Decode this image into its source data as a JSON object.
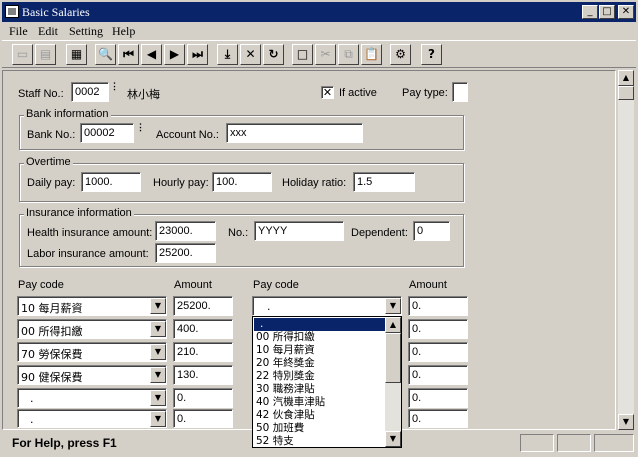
{
  "window": {
    "title": "Basic Salaries",
    "min_label": "_",
    "max_label": "□",
    "close_label": "✕"
  },
  "menu": [
    "File",
    "Edit",
    "Setting",
    "Help"
  ],
  "toolbar": {
    "icons": [
      "print-preview-icon",
      "print-icon",
      "list-view-icon",
      "search-icon",
      "first-record-icon",
      "previous-record-icon",
      "next-record-icon",
      "last-record-icon",
      "save-icon",
      "cancel-icon",
      "refresh-icon",
      "new-record-icon",
      "cut-icon",
      "copy-icon",
      "paste-icon",
      "settings-icon",
      "help-icon"
    ],
    "glyphs": [
      "▭",
      "▤",
      "▦",
      "🔍",
      "⏮",
      "◀",
      "▶",
      "⏭",
      "⤓",
      "✕",
      "↻",
      "□",
      "✂",
      "⧉",
      "📋",
      "⚙",
      "?"
    ]
  },
  "staff": {
    "label": "Staff No.:",
    "value": "0002",
    "name": "林小梅",
    "if_active_label": "If active",
    "if_active_checked": true,
    "pay_type_label": "Pay type:",
    "pay_type_value": ""
  },
  "bank": {
    "title": "Bank information",
    "bank_no_label": "Bank No.:",
    "bank_no_value": "00002",
    "account_label": "Account No.:",
    "account_value": "xxx"
  },
  "overtime": {
    "title": "Overtime",
    "daily_label": "Daily pay:",
    "daily_value": "1000.",
    "hourly_label": "Hourly pay:",
    "hourly_value": "100.",
    "holiday_label": "Holiday ratio:",
    "holiday_value": "1.5"
  },
  "insurance": {
    "title": "Insurance information",
    "health_label": "Health insurance amount:",
    "health_value": "23000.",
    "no_label": "No.:",
    "no_value": "YYYY",
    "dependent_label": "Dependent:",
    "dependent_value": "0",
    "labor_label": "Labor insurance amount:",
    "labor_value": "25200."
  },
  "paygrid": {
    "pay_code_header": "Pay code",
    "amount_header": "Amount",
    "left_rows": [
      {
        "code": "10 每月薪資",
        "amount": "25200."
      },
      {
        "code": "00 所得扣繳",
        "amount": "400."
      },
      {
        "code": "70 勞保保費",
        "amount": "210."
      },
      {
        "code": "90 健保保費",
        "amount": "130."
      },
      {
        "code": ".",
        "amount": "0."
      },
      {
        "code": ".",
        "amount": "0."
      }
    ],
    "right_rows": [
      {
        "code": ".",
        "amount": "0."
      },
      {
        "amount": "0."
      },
      {
        "amount": "0."
      },
      {
        "amount": "0."
      },
      {
        "amount": "0."
      },
      {
        "amount": "0."
      }
    ]
  },
  "dropdown": {
    "items": [
      ".",
      "00 所得扣繳",
      "10 每月薪資",
      "20 年終獎金",
      "22 特別獎金",
      "30 職務津貼",
      "40 汽機車津貼",
      "42 伙食津貼",
      "50 加班費",
      "52 特支"
    ],
    "selected_index": 0
  },
  "status": {
    "text": "For Help, press F1"
  }
}
